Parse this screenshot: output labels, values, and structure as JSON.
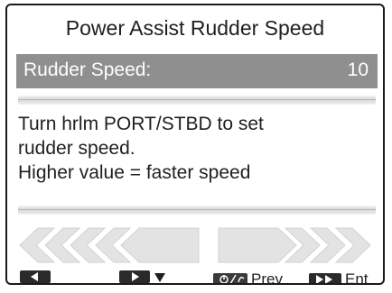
{
  "screen": {
    "title": "Power Assist Rudder Speed",
    "setting": {
      "label": "Rudder Speed:",
      "value": "10"
    },
    "message": {
      "line1": "Turn hrlm PORT/STBD to set",
      "line2": "rudder speed.",
      "line3": "Higher value = faster speed"
    }
  },
  "softkeys": {
    "left_icon": "left-arrow-key-icon",
    "right_icon": "right-arrow-key-icon",
    "down_icon": "down-triangle-icon",
    "prev_icon": "power-key-icon",
    "prev_label": "Prev",
    "ent_icon": "double-right-arrow-key-icon",
    "ent_label": "Ent"
  },
  "colors": {
    "highlight_bar": "#8f8f8f",
    "text": "#1f1f1f",
    "arrow_fill": "#e3e3e3"
  }
}
